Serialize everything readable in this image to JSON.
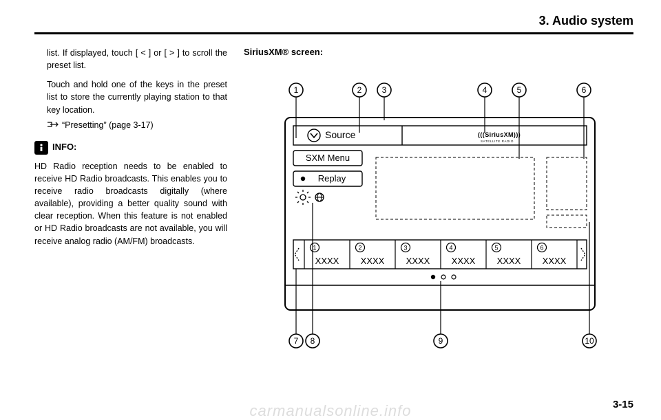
{
  "header": {
    "chapter": "3. Audio system"
  },
  "left": {
    "p1": "list. If displayed, touch [ < ] or [ > ] to scroll the preset list.",
    "p2": "Touch and hold one of the keys in the preset list to store the currently playing station to that key location.",
    "xref": "“Presetting” (page 3-17)",
    "info_label": "INFO:",
    "p3": "HD Radio reception needs to be enabled to receive HD Radio broadcasts. This enables you to receive radio broadcasts digitally (where available), providing a better quality sound with clear reception. When this feature is not enabled or HD Radio broadcasts are not available, you will receive analog radio (AM/FM) broadcasts."
  },
  "right": {
    "title": "SiriusXM® screen:",
    "buttons": {
      "source": "Source",
      "sxm_menu": "SXM Menu",
      "replay": "Replay"
    },
    "logo_top": "SiriusXM",
    "logo_bottom": "SATELLITE RADIO",
    "presets": [
      "XXXX",
      "XXXX",
      "XXXX",
      "XXXX",
      "XXXX",
      "XXXX"
    ],
    "callouts_top": [
      "1",
      "2",
      "3",
      "4",
      "5",
      "6"
    ],
    "callouts_bottom": [
      "7",
      "8",
      "9",
      "10"
    ],
    "preset_nums": [
      "1",
      "2",
      "3",
      "4",
      "5",
      "6"
    ]
  },
  "pagenum": "3-15",
  "watermark": "carmanualsonline.info"
}
